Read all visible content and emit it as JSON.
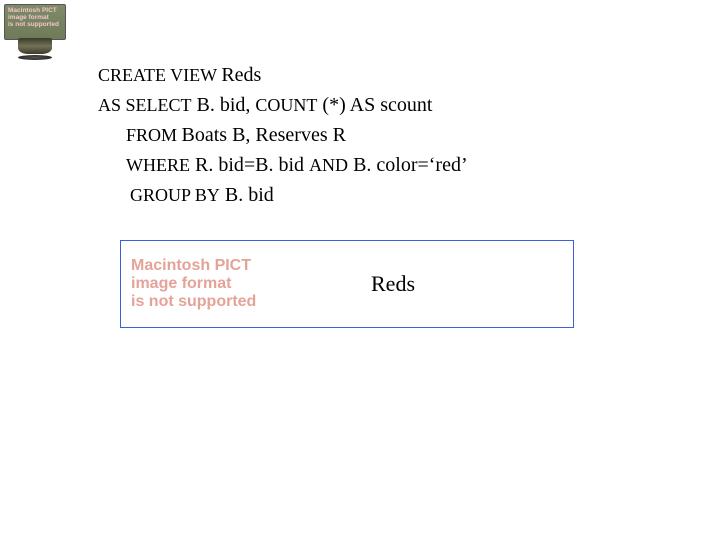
{
  "badge": {
    "line1": "Macintosh PICT",
    "line2": "image format",
    "line3": "is not supported"
  },
  "sql": {
    "l1_kw": "CREATE VIEW ",
    "l1_rest": "Reds",
    "l2_kw1": "AS SELECT",
    "l2_mid": "  B. bid,  ",
    "l2_kw2": "COUNT",
    "l2_rest": " (*) AS scount",
    "l3_kw": "FROM ",
    "l3_rest": "Boats B, Reserves R",
    "l4_kw": "WHERE",
    "l4_mid": "  R. bid=B. bid ",
    "l4_kw2": "AND",
    "l4_rest": "   B. color=‘red’",
    "l5_kw": "GROUP BY",
    "l5_rest": "  B. bid"
  },
  "box": {
    "pict_line1": "Macintosh PICT",
    "pict_line2": "image format",
    "pict_line3": "is not supported",
    "label": "Reds"
  }
}
